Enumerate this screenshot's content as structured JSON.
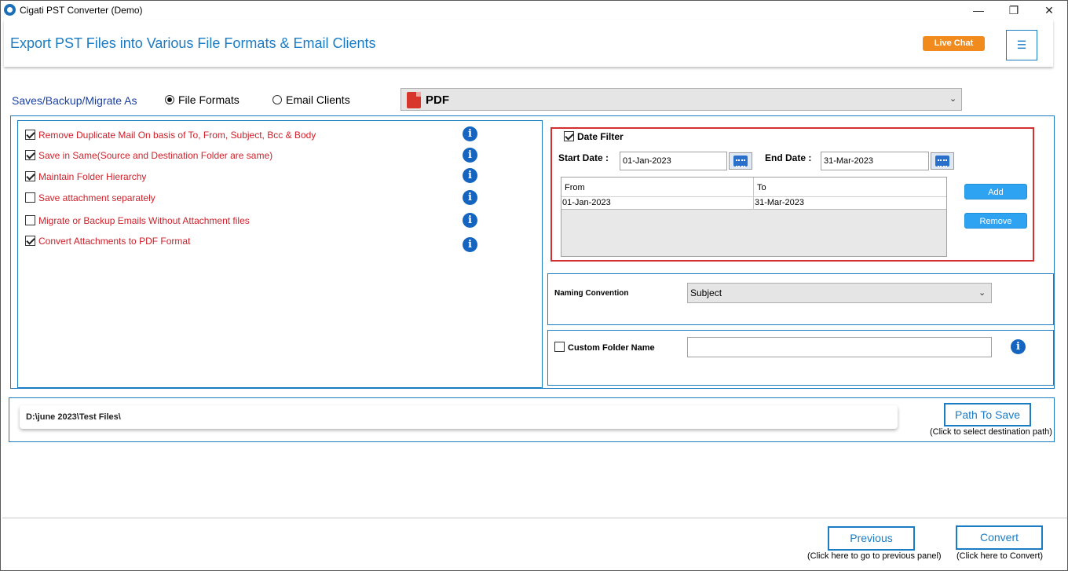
{
  "window": {
    "title": "Cigati PST Converter (Demo)",
    "controls": {
      "minimize": "—",
      "maximize": "❐",
      "close": "✕"
    }
  },
  "header": {
    "title": "Export PST Files into Various File Formats & Email Clients",
    "live_chat": "Live Chat",
    "menu_icon": "☰"
  },
  "saves": {
    "label": "Saves/Backup/Migrate As",
    "options": [
      {
        "label": "File Formats",
        "selected": true
      },
      {
        "label": "Email Clients",
        "selected": false
      }
    ],
    "format_value": "PDF"
  },
  "options": [
    {
      "label": "Remove Duplicate Mail On basis of To, From, Subject, Bcc & Body",
      "checked": true
    },
    {
      "label": "Save in Same(Source and Destination Folder are same)",
      "checked": true
    },
    {
      "label": "Maintain Folder Hierarchy",
      "checked": true
    },
    {
      "label": "Save attachment separately",
      "checked": false
    },
    {
      "label": "Migrate or Backup Emails Without Attachment files",
      "checked": false
    },
    {
      "label": "Convert Attachments to PDF Format",
      "checked": true
    }
  ],
  "info_glyph": "i",
  "date_filter": {
    "label": "Date Filter",
    "checked": true,
    "start_label": "Start Date :",
    "start_value": "01-Jan-2023",
    "end_label": "End Date :",
    "end_value": "31-Mar-2023",
    "columns": [
      "From",
      "To"
    ],
    "rows": [
      [
        "01-Jan-2023",
        "31-Mar-2023"
      ]
    ],
    "add_label": "Add",
    "remove_label": "Remove"
  },
  "naming": {
    "label": "Naming Convention",
    "value": "Subject"
  },
  "custom_folder": {
    "label": "Custom Folder Name",
    "checked": false,
    "value": ""
  },
  "path": {
    "value": "D:\\june 2023\\Test Files\\",
    "button": "Path To Save",
    "hint": "(Click to select destination path)"
  },
  "footer": {
    "previous": "Previous",
    "previous_hint": "(Click here to go to previous panel)",
    "convert": "Convert",
    "convert_hint": "(Click here to Convert)"
  },
  "colors": {
    "accent": "#1b7cc4",
    "option_text": "#d0202a",
    "live_chat": "#f28b1e",
    "date_box_border": "#d32f2f",
    "action_button": "#2ea3f2"
  }
}
